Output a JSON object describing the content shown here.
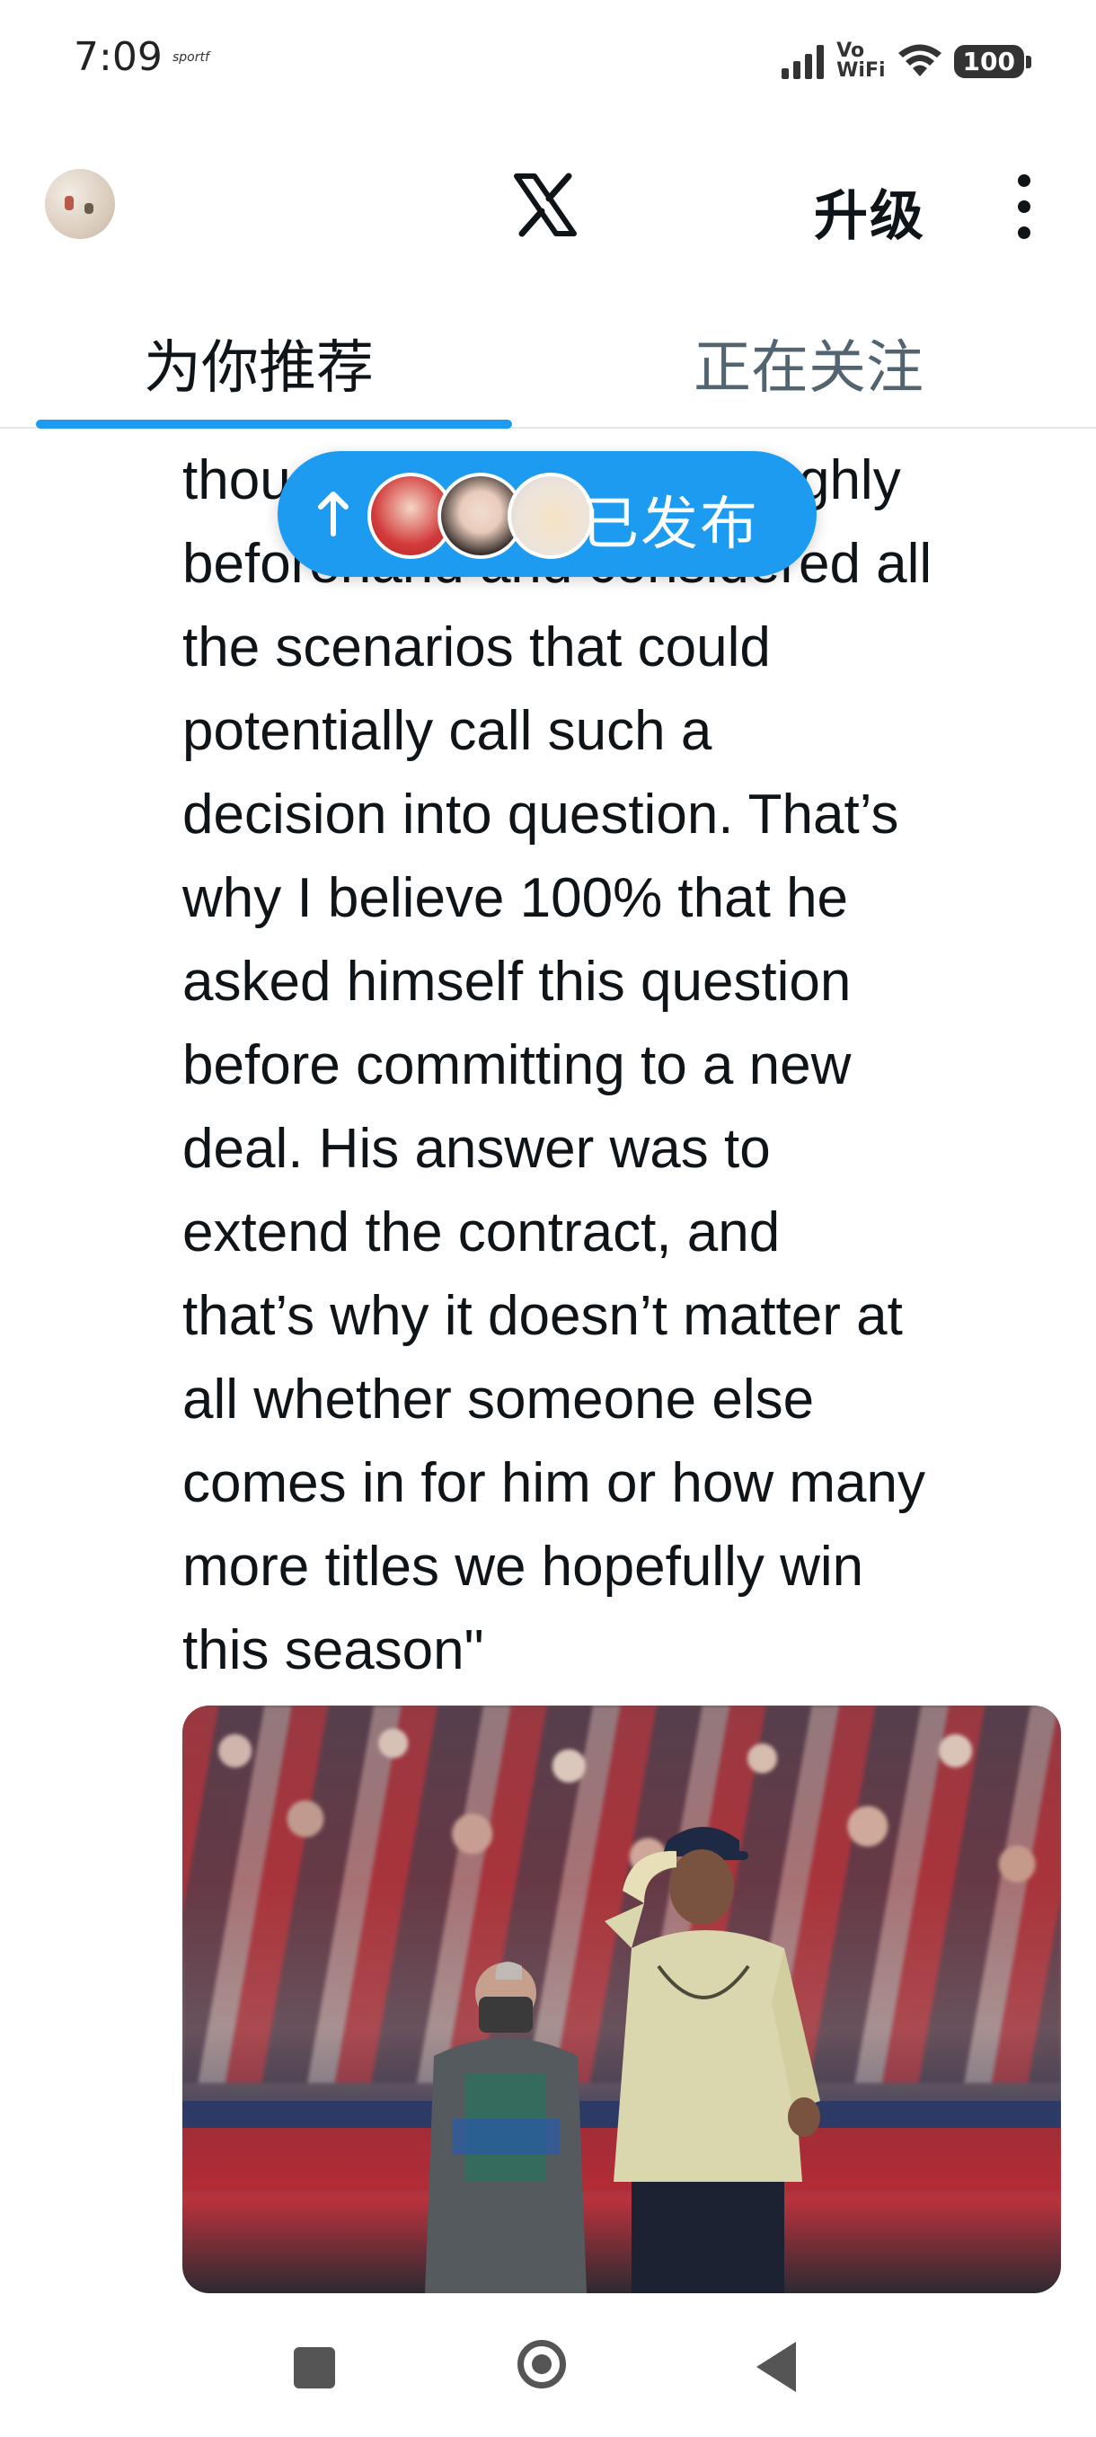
{
  "status_bar": {
    "time": "7:09",
    "app_icon": "sportf",
    "network_label_top": "Vo",
    "network_label_bottom": "WiFi",
    "battery": "100",
    "icons": [
      "signal-icon",
      "vowifi-icon",
      "wifi-icon",
      "battery-icon"
    ]
  },
  "header": {
    "logo": "x-logo",
    "upgrade_label": "升级",
    "more_icon": "more-vertical-icon"
  },
  "tabs": [
    {
      "label": "为你推荐",
      "active": true
    },
    {
      "label": "正在关注",
      "active": false
    }
  ],
  "new_posts_pill": {
    "arrow_icon": "arrow-up-icon",
    "label": "已发布"
  },
  "tweet": {
    "text": "thought about this thoroughly\nbeforehand and considered all\nthe scenarios that could\npotentially call such a\ndecision into question. That’s\nwhy I believe 100% that he\nasked himself this question\nbefore committing to a new\ndeal. His answer was to\nextend the contract, and\nthat’s why it doesn’t matter at\nall whether someone else\ncomes in for him or how many\nmore titles we hopefully win\nthis season\""
  },
  "nav_bar": {
    "icons": [
      "recents-square-icon",
      "home-circle-icon",
      "back-triangle-icon"
    ]
  },
  "colors": {
    "accent": "#1d9bf0",
    "text": "#0f1419",
    "muted": "#536471"
  }
}
